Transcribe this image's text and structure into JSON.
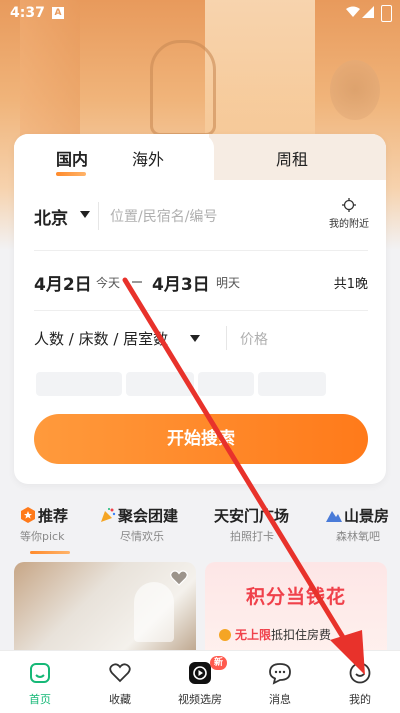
{
  "status_bar": {
    "time": "4:37",
    "notif_letter": "A"
  },
  "search_card": {
    "tabs": [
      {
        "label": "国内",
        "active": true
      },
      {
        "label": "海外",
        "active": false
      },
      {
        "label": "周租",
        "active": false
      }
    ],
    "city": "北京",
    "search_placeholder": "位置/民宿名/编号",
    "nearby_label": "我的附近",
    "checkin": {
      "date": "4月2日",
      "tag": "今天"
    },
    "checkout": {
      "date": "4月3日",
      "tag": "明天"
    },
    "nights": "共1晚",
    "guests_label": "人数 / 床数 / 居室数",
    "price_placeholder": "价格",
    "search_button": "开始搜索"
  },
  "categories": [
    {
      "title": "推荐",
      "subtitle": "等你pick",
      "icon": "star-hex-icon"
    },
    {
      "title": "聚会团建",
      "subtitle": "尽情欢乐",
      "icon": "party-popper-icon"
    },
    {
      "title": "天安门广场",
      "subtitle": "拍照打卡",
      "icon": ""
    },
    {
      "title": "山景房",
      "subtitle": "森林氧吧",
      "icon": "mountain-icon"
    }
  ],
  "promo": {
    "title": "积分当钱花",
    "line_highlight": "无上限",
    "line_rest": "抵扣住房费"
  },
  "bottom_nav": [
    {
      "label": "首页",
      "icon": "home-icon",
      "active": true
    },
    {
      "label": "收藏",
      "icon": "heart-icon",
      "active": false
    },
    {
      "label": "视频选房",
      "icon": "video-play-icon",
      "active": false,
      "badge": "新"
    },
    {
      "label": "消息",
      "icon": "chat-bubble-icon",
      "active": false
    },
    {
      "label": "我的",
      "icon": "profile-icon",
      "active": false
    }
  ],
  "colors": {
    "accent": "#ff8a2b",
    "nav_active": "#16b877",
    "promo_red": "#f0414b",
    "arrow": "#e8322b"
  }
}
